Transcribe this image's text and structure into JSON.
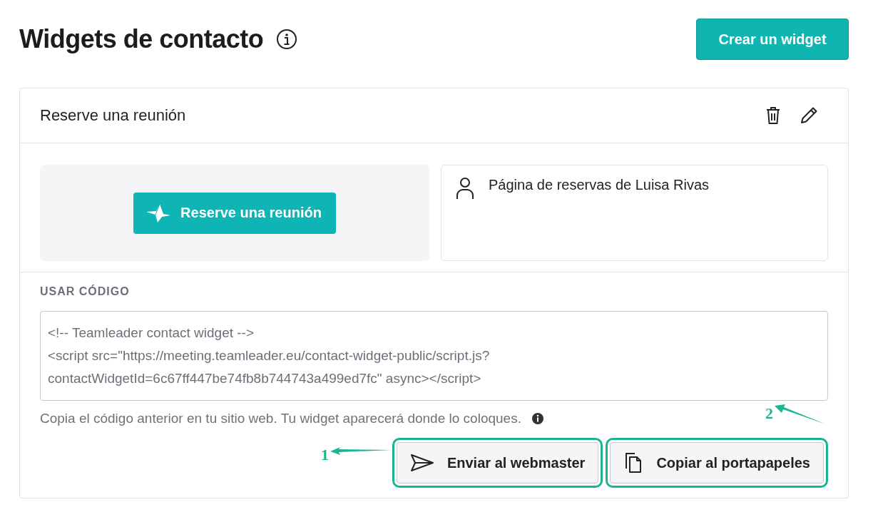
{
  "page": {
    "title": "Widgets de contacto",
    "create_button": "Crear un widget"
  },
  "widget": {
    "title": "Reserve una reunión",
    "preview_button": "Reserve una reunión",
    "booking_page": "Página de reservas de Luisa Rivas",
    "code_section": {
      "label": "USAR CÓDIGO",
      "code_lines": [
        "<!-- Teamleader contact widget -->",
        "<script src=\"https://meeting.teamleader.eu/contact-widget-public/script.js?",
        "contactWidgetId=6c67ff447be74fb8b744743a499ed7fc\" async></script>"
      ],
      "help_text": "Copia el código anterior en tu sitio web. Tu widget aparecerá donde lo coloques."
    },
    "actions": [
      {
        "kind": "send",
        "label": "Enviar al webmaster",
        "callout": "1"
      },
      {
        "kind": "copy",
        "label": "Copiar al portapapeles",
        "callout": "2"
      }
    ]
  }
}
